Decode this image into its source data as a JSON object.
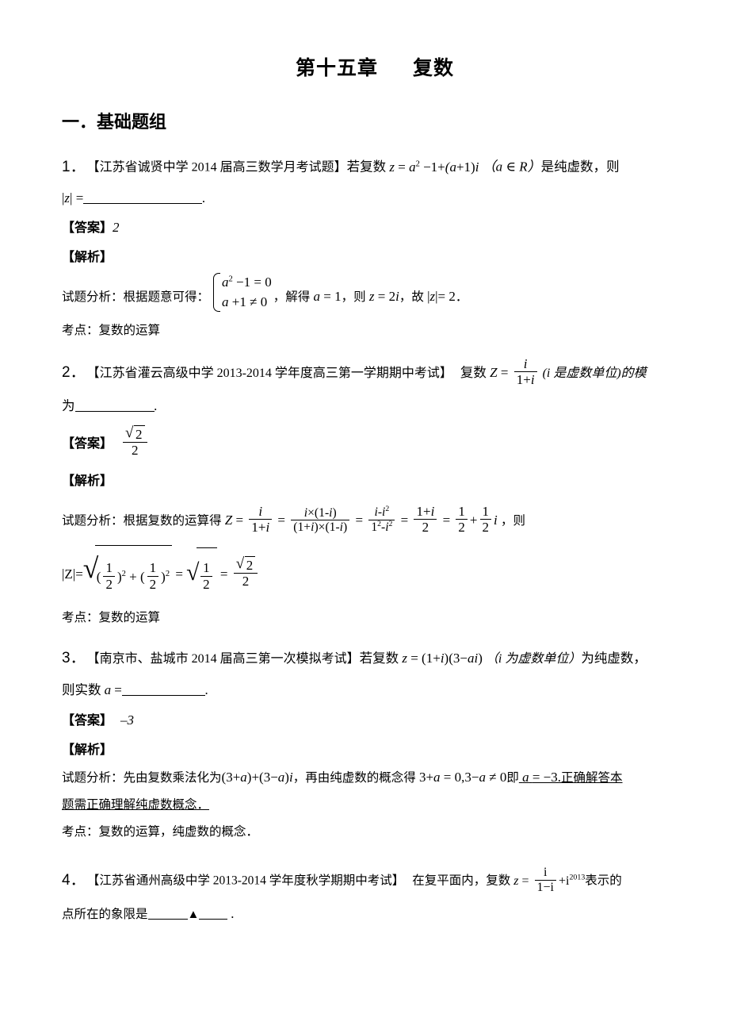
{
  "document": {
    "title_chapter": "第十五章",
    "title_topic": "复数",
    "section_heading": "一．基础题组"
  },
  "labels": {
    "answer": "【答案】",
    "analysis": "【解析】",
    "analysis_prefix": "试题分析：",
    "point_prefix": "考点："
  },
  "questions": [
    {
      "number": "1．",
      "source": "【江苏省诚贤中学 2014 届高三数学月考试题】",
      "stem_pre": "若复数",
      "stem_math": "z = a² − 1 + (a+1)i",
      "stem_cond": "（a ∈ R）",
      "stem_post": "是纯虚数，则",
      "blank_line_pre": "|z| =",
      "blank_line_post": "．",
      "answer": "2",
      "analysis_lead": "根据题意可得：",
      "case1": "a² − 1 = 0",
      "case2": "a + 1 ≠ 0",
      "analysis_mid1": "，解得",
      "analysis_eq1": "a = 1",
      "analysis_mid2": "，则",
      "analysis_eq2": "z = 2i",
      "analysis_mid3": "，故",
      "analysis_eq3": "|z| = 2",
      "analysis_end": "．",
      "point": "复数的运算"
    },
    {
      "number": "2．",
      "source": "【江苏省灌云高级中学 2013-2014 学年度高三第一学期期中考试】",
      "stem_pre": "复数",
      "stem_Z": "Z =",
      "frac_num": "i",
      "frac_den": "1 + i",
      "stem_cond": "(i 是虚数单位)的模",
      "blank_line_pre": "为",
      "blank_line_post": "．",
      "answer_num": "√2",
      "answer_den": "2",
      "analysis_lead": "根据复数的运算得",
      "chain": [
        "Z =",
        "i / (1+i)",
        "=",
        "i×(1-i) / ((1+i)×(1-i))",
        "=",
        "i·i² / (1²·i²)",
        "=",
        "(1+i)/2",
        "=",
        "1/2 + 1/2 i"
      ],
      "analysis_tail": "，则",
      "modulus_line": "|Z| = √((1/2)² + (1/2)²) = √(1/2) = √2/2",
      "point": "复数的运算"
    },
    {
      "number": "3．",
      "source": "【南京市、盐城市 2014 届高三第一次模拟考试】",
      "stem_pre": "若复数",
      "stem_math": "z = (1+i)(3 − ai)",
      "stem_cond": "（i 为虚数单位）",
      "stem_post": "为纯虚数，",
      "blank_line_pre": "则实数 a =",
      "blank_line_post": "．",
      "answer": "–3",
      "analysis_line1_a": "先由复数乘法化为",
      "analysis_line1_m1": "(3 + a) + (3 − a)i",
      "analysis_line1_b": "，再由纯虚数的概念得",
      "analysis_line1_m2": "3 + a = 0, 3 − a ≠ 0",
      "analysis_line1_c": "即",
      "analysis_line1_m3": "a = −3.",
      "analysis_line1_d": "正确解答本",
      "analysis_line2": "题需正确理解纯虚数概念．",
      "point": "复数的运算，纯虚数的概念．"
    },
    {
      "number": "4．",
      "source": "【江苏省通州高级中学 2013-2014 学年度秋学期期中考试】",
      "stem_pre": "在复平面内，复数",
      "stem_z": "z =",
      "frac_num": "i",
      "frac_den": "1 − i",
      "stem_plus": "+ i",
      "stem_exp": "2013",
      "stem_post": "表示的",
      "blank_line_pre": "点所在的象限是",
      "blank_marker": "▲",
      "blank_line_post": "．"
    }
  ]
}
